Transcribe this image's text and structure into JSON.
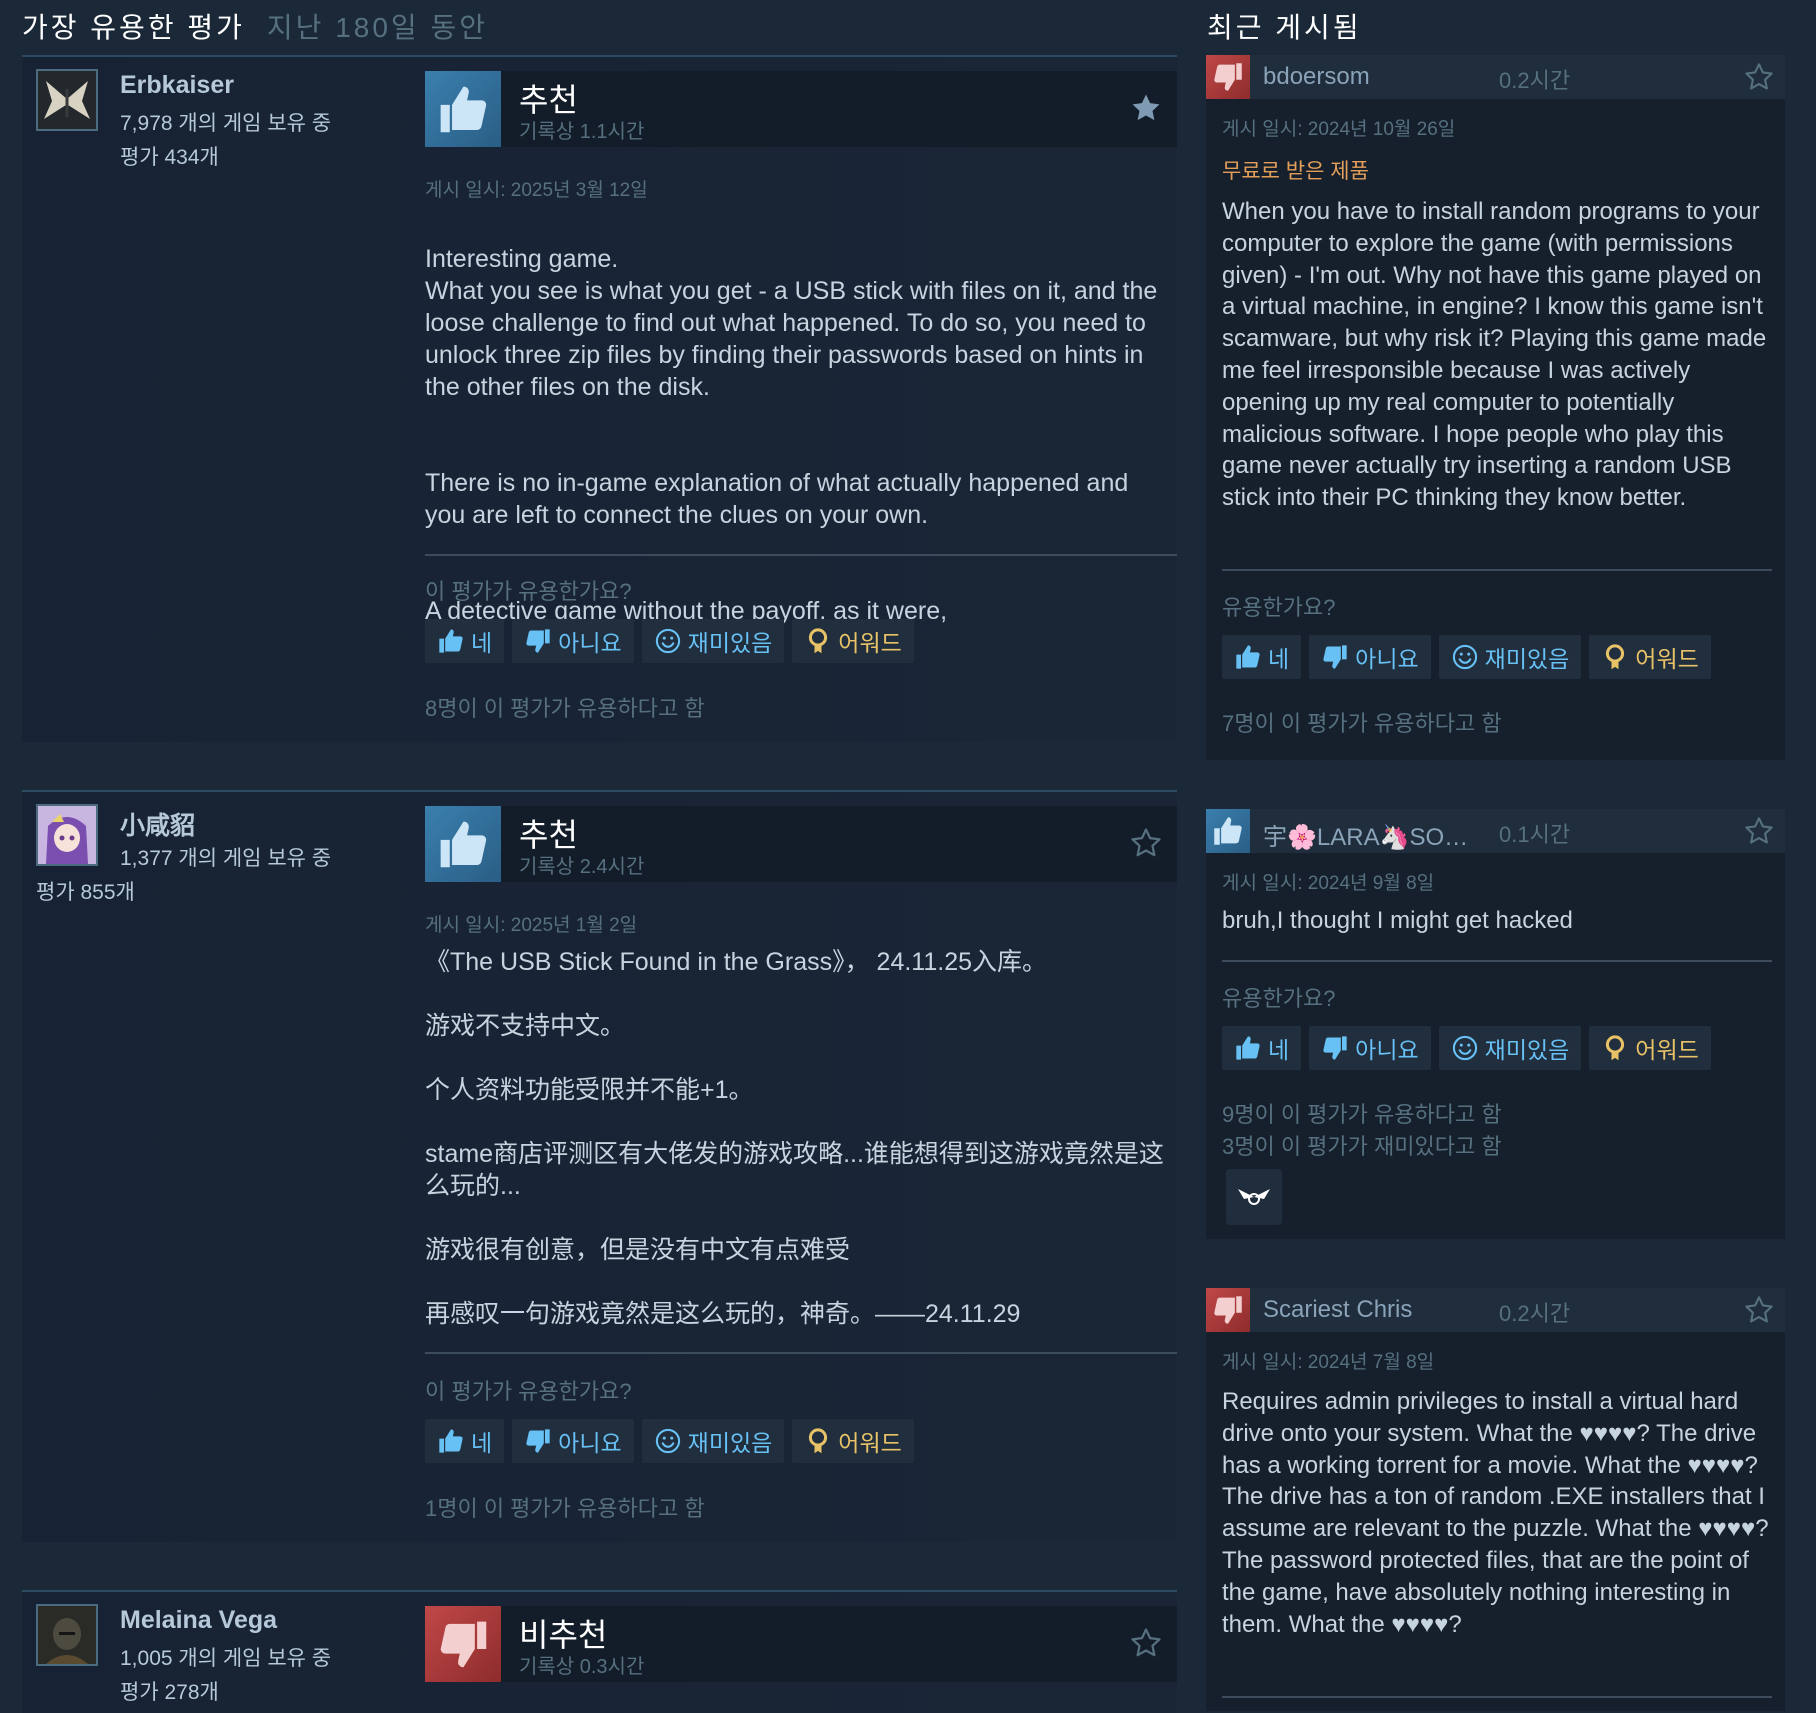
{
  "left_title": "가장 유용한 평가",
  "left_subtitle": "지난 180일 동안",
  "right_title": "최근 게시됨",
  "left_reviews": [
    {
      "author": "Erbkaiser",
      "games_owned": "7,978 개의 게임 보유 중",
      "review_count": "평가 434개",
      "verdict": "추천",
      "hours": "기록상 1.1시간",
      "posted": "게시 일시: 2025년 3월 12일",
      "paragraphs": [
        "Interesting game.\nWhat you see is what you get - a USB stick with files on it, and the loose challenge to find out what happened. To do so, you need to unlock three zip files by finding their passwords based on hints in the other files on the disk.",
        "There is no in-game explanation of what actually happened and you are left to connect the clues on your own.",
        "A detective game without the payoff, as it were,"
      ],
      "helpful_question": "이 평가가 유용한가요?",
      "helpful_count": "8명이 이 평가가 유용하다고 함"
    },
    {
      "author": "小咸貂",
      "games_owned": "1,377 개의 게임 보유 중",
      "review_count": "평가 855개",
      "verdict": "추천",
      "hours": "기록상 2.4시간",
      "posted": "게시 일시: 2025년 1월 2일",
      "paragraphs": [
        "《The USB Stick Found in the Grass》， 24.11.25入库。",
        "游戏不支持中文。",
        "个人资料功能受限并不能+1。",
        "stame商店评测区有大佬发的游戏攻略...谁能想得到这游戏竟然是这么玩的...",
        "游戏很有创意，但是没有中文有点难受",
        "再感叹一句游戏竟然是这么玩的，神奇。——24.11.29"
      ],
      "helpful_question": "이 평가가 유용한가요?",
      "helpful_count": "1명이 이 평가가 유용하다고 함"
    },
    {
      "author": "Melaina Vega",
      "games_owned": "1,005 개의 게임 보유 중",
      "review_count": "평가 278개",
      "verdict": "비추천",
      "hours": "기록상 0.3시간"
    }
  ],
  "right_reviews": [
    {
      "author": "bdoersom",
      "hours": "0.2시간",
      "posted": "게시 일시: 2024년 10월 26일",
      "free_label": "무료로 받은 제품",
      "text": "When you have to install random programs to your computer to explore the game (with permissions given) - I'm out. Why not have this game played on a virtual machine, in engine? I know this game isn't scamware, but why risk it? Playing this game made me feel irresponsible because I was actively opening up my real computer to potentially malicious software. I hope people who play this game never actually try inserting a random USB stick into their PC thinking they know better.",
      "helpful_question": "유용한가요?",
      "helpful_count": "7명이 이 평가가 유용하다고 함"
    },
    {
      "author": "宇🌸LARA🦄SOU...",
      "hours": "0.1시간",
      "posted": "게시 일시: 2024년 9월 8일",
      "text": "bruh,I thought I might get hacked",
      "helpful_question": "유용한가요?",
      "helpful_count": "9명이 이 평가가 유용하다고 함",
      "funny_count": "3명이 이 평가가 재미있다고 함"
    },
    {
      "author": "Scariest Chris",
      "hours": "0.2시간",
      "posted": "게시 일시: 2024년 7월 8일",
      "text": "Requires admin privileges to install a virtual hard drive onto your system. What the ♥♥♥♥? The drive has a working torrent for a movie. What the ♥♥♥♥? The drive has a ton of random .EXE installers that I assume are relevant to the puzzle. What the ♥♥♥♥? The password protected files, that are the point of the game, have absolutely nothing interesting in them. What the ♥♥♥♥?"
    }
  ],
  "buttons": {
    "yes": "네",
    "no": "아니요",
    "funny": "재미있음",
    "award": "어워드"
  },
  "colors": {
    "background": "#1b2838",
    "link": "#67c1f5",
    "muted": "#56707f",
    "free_product": "#e39f5a",
    "award": "#e8c267",
    "thumb_up": "#3a7fae",
    "thumb_down": "#c04848"
  },
  "icons": [
    "thumbs-up-icon",
    "thumbs-down-icon",
    "smiley-icon",
    "award-icon",
    "star-icon"
  ]
}
